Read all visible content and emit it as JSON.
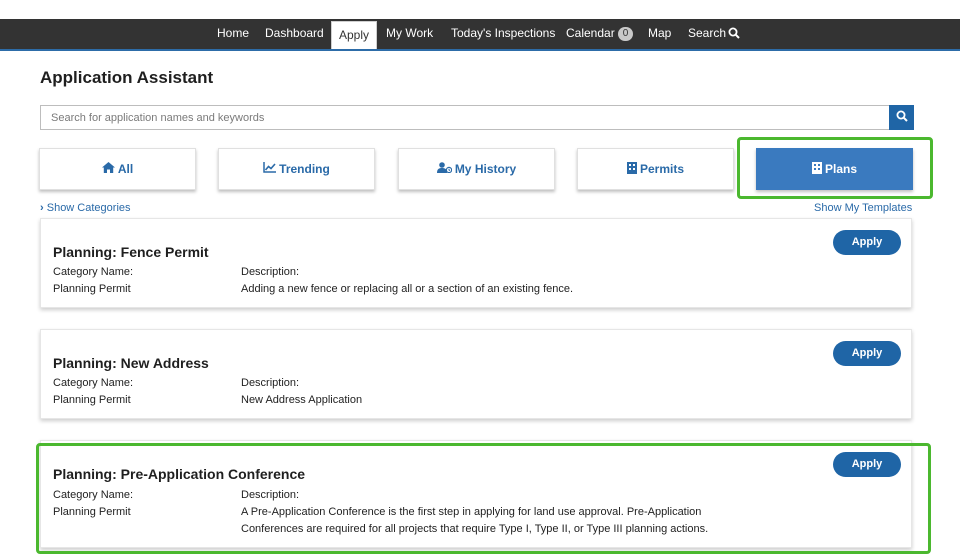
{
  "nav": {
    "items": [
      "Home",
      "Dashboard",
      "Apply",
      "My Work",
      "Today's Inspections",
      "Calendar",
      "Map",
      "Search"
    ],
    "active": "Apply",
    "calendar_badge": "0"
  },
  "page": {
    "title": "Application Assistant"
  },
  "search": {
    "placeholder": "Search for application names and keywords"
  },
  "tabs": [
    {
      "label": "All",
      "icon": "home-icon"
    },
    {
      "label": "Trending",
      "icon": "line-chart-icon"
    },
    {
      "label": "My History",
      "icon": "user-history-icon"
    },
    {
      "label": "Permits",
      "icon": "building-icon"
    },
    {
      "label": "Plans",
      "icon": "building-icon",
      "selected": true
    }
  ],
  "links": {
    "show_categories": "Show Categories",
    "show_templates": "Show My Templates"
  },
  "cards": [
    {
      "title": "Planning: Fence Permit",
      "category_label": "Category Name:",
      "category_value": "Planning Permit",
      "description_label": "Description:",
      "description": "Adding a new fence or replacing all or a section of an existing fence.",
      "apply": "Apply"
    },
    {
      "title": "Planning: New Address",
      "category_label": "Category Name:",
      "category_value": "Planning Permit",
      "description_label": "Description:",
      "description": "New Address Application",
      "apply": "Apply"
    },
    {
      "title": "Planning: Pre-Application Conference",
      "category_label": "Category Name:",
      "category_value": "Planning Permit",
      "description_label": "Description:",
      "description_line1": "A Pre-Application Conference is the first step in applying for land use approval. Pre-Application",
      "description_line2": "Conferences are required for all projects that require Type I, Type II, or Type III planning actions.",
      "apply": "Apply"
    }
  ],
  "colors": {
    "nav_bg": "#333333",
    "accent": "#1f65a6",
    "selected_tab": "#3a7abf",
    "highlight": "#4bb82f"
  }
}
